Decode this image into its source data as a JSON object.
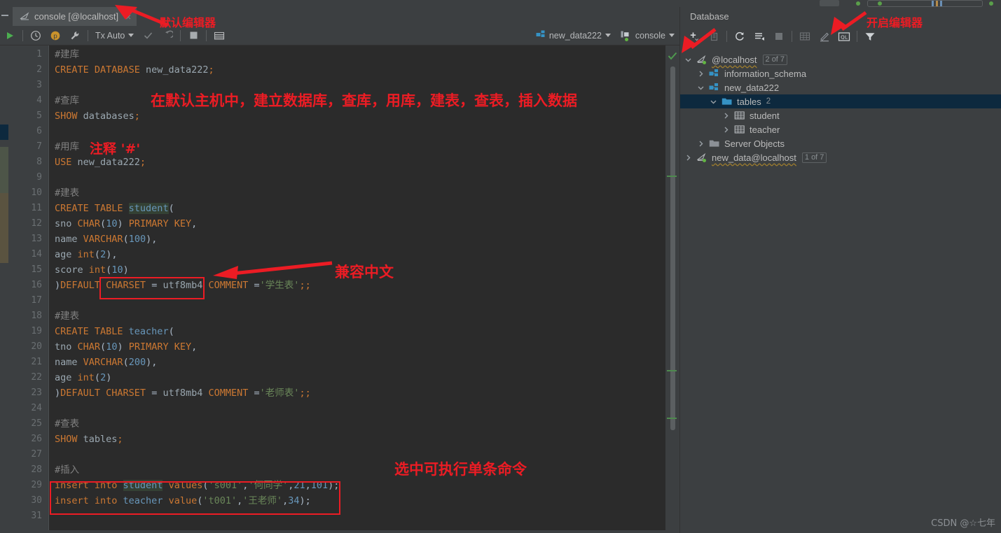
{
  "window": {
    "editor_tab": {
      "label": "console [@localhost]",
      "icon": "console-tab-icon",
      "close": "×"
    }
  },
  "editor_toolbar": {
    "run": "run-icon",
    "history": "history-icon",
    "profile": "profile-icon",
    "wrench": "wrench-icon",
    "tx_mode": "Tx Auto",
    "commit": "commit-check-icon",
    "rollback": "rollback-icon",
    "stop": "stop-icon",
    "grid": "table-grid-icon",
    "schema_chip": "new_data222",
    "session_chip": "console"
  },
  "code": {
    "lines": [
      {
        "n": 1,
        "tokens": [
          {
            "t": "#建库",
            "c": "cm"
          }
        ]
      },
      {
        "n": 2,
        "tokens": [
          {
            "t": "CREATE DATABASE ",
            "c": "k"
          },
          {
            "t": "new_data222",
            "c": "id"
          },
          {
            "t": ";",
            "c": "k"
          }
        ]
      },
      {
        "n": 3,
        "tokens": []
      },
      {
        "n": 4,
        "tokens": [
          {
            "t": "#查库",
            "c": "cm"
          }
        ]
      },
      {
        "n": 5,
        "tokens": [
          {
            "t": "SHOW ",
            "c": "k"
          },
          {
            "t": "databases",
            "c": "id"
          },
          {
            "t": ";",
            "c": "k"
          }
        ]
      },
      {
        "n": 6,
        "tokens": []
      },
      {
        "n": 7,
        "tokens": [
          {
            "t": "#用库",
            "c": "cm"
          }
        ]
      },
      {
        "n": 8,
        "tokens": [
          {
            "t": "USE ",
            "c": "k"
          },
          {
            "t": "new_data222",
            "c": "id"
          },
          {
            "t": ";",
            "c": "k"
          }
        ]
      },
      {
        "n": 9,
        "tokens": []
      },
      {
        "n": 10,
        "tokens": [
          {
            "t": "#建表",
            "c": "cm"
          }
        ]
      },
      {
        "n": 11,
        "tokens": [
          {
            "t": "CREATE TABLE ",
            "c": "k"
          },
          {
            "t": "student",
            "c": "tb hl"
          },
          {
            "t": "(",
            "c": "pn"
          }
        ]
      },
      {
        "n": 12,
        "tokens": [
          {
            "t": "sno",
            "c": "id"
          },
          {
            "t": " ",
            "c": "pn"
          },
          {
            "t": "CHAR",
            "c": "k"
          },
          {
            "t": "(",
            "c": "pn"
          },
          {
            "t": "10",
            "c": "nm"
          },
          {
            "t": ") ",
            "c": "pn"
          },
          {
            "t": "PRIMARY KEY",
            "c": "k"
          },
          {
            "t": ",",
            "c": "pn"
          }
        ]
      },
      {
        "n": 13,
        "tokens": [
          {
            "t": "name",
            "c": "id"
          },
          {
            "t": " ",
            "c": "pn"
          },
          {
            "t": "VARCHAR",
            "c": "k"
          },
          {
            "t": "(",
            "c": "pn"
          },
          {
            "t": "100",
            "c": "nm"
          },
          {
            "t": "),",
            "c": "pn"
          }
        ]
      },
      {
        "n": 14,
        "tokens": [
          {
            "t": "age",
            "c": "id"
          },
          {
            "t": " ",
            "c": "pn"
          },
          {
            "t": "int",
            "c": "k"
          },
          {
            "t": "(",
            "c": "pn"
          },
          {
            "t": "2",
            "c": "nm"
          },
          {
            "t": "),",
            "c": "pn"
          }
        ]
      },
      {
        "n": 15,
        "tokens": [
          {
            "t": "score",
            "c": "id"
          },
          {
            "t": " ",
            "c": "pn"
          },
          {
            "t": "int",
            "c": "k"
          },
          {
            "t": "(",
            "c": "pn"
          },
          {
            "t": "10",
            "c": "nm"
          },
          {
            "t": ")",
            "c": "pn"
          }
        ]
      },
      {
        "n": 16,
        "tokens": [
          {
            "t": ")",
            "c": "pn"
          },
          {
            "t": "DEFAULT CHARSET",
            "c": "k"
          },
          {
            "t": " = ",
            "c": "pn"
          },
          {
            "t": "utf8mb4",
            "c": "id"
          },
          {
            "t": " ",
            "c": "pn"
          },
          {
            "t": "COMMENT",
            "c": "k"
          },
          {
            "t": " =",
            "c": "pn"
          },
          {
            "t": "'学生表'",
            "c": "st"
          },
          {
            "t": ";;",
            "c": "k"
          }
        ]
      },
      {
        "n": 17,
        "tokens": []
      },
      {
        "n": 18,
        "tokens": [
          {
            "t": "#建表",
            "c": "cm"
          }
        ]
      },
      {
        "n": 19,
        "tokens": [
          {
            "t": "CREATE TABLE ",
            "c": "k"
          },
          {
            "t": "teacher",
            "c": "tb"
          },
          {
            "t": "(",
            "c": "pn"
          }
        ]
      },
      {
        "n": 20,
        "tokens": [
          {
            "t": "tno",
            "c": "id"
          },
          {
            "t": " ",
            "c": "pn"
          },
          {
            "t": "CHAR",
            "c": "k"
          },
          {
            "t": "(",
            "c": "pn"
          },
          {
            "t": "10",
            "c": "nm"
          },
          {
            "t": ") ",
            "c": "pn"
          },
          {
            "t": "PRIMARY KEY",
            "c": "k"
          },
          {
            "t": ",",
            "c": "pn"
          }
        ]
      },
      {
        "n": 21,
        "tokens": [
          {
            "t": "name",
            "c": "id"
          },
          {
            "t": " ",
            "c": "pn"
          },
          {
            "t": "VARCHAR",
            "c": "k"
          },
          {
            "t": "(",
            "c": "pn"
          },
          {
            "t": "200",
            "c": "nm"
          },
          {
            "t": "),",
            "c": "pn"
          }
        ]
      },
      {
        "n": 22,
        "tokens": [
          {
            "t": "age",
            "c": "id"
          },
          {
            "t": " ",
            "c": "pn"
          },
          {
            "t": "int",
            "c": "k"
          },
          {
            "t": "(",
            "c": "pn"
          },
          {
            "t": "2",
            "c": "nm"
          },
          {
            "t": ")",
            "c": "pn"
          }
        ]
      },
      {
        "n": 23,
        "tokens": [
          {
            "t": ")",
            "c": "pn"
          },
          {
            "t": "DEFAULT CHARSET",
            "c": "k"
          },
          {
            "t": " = ",
            "c": "pn"
          },
          {
            "t": "utf8mb4",
            "c": "id"
          },
          {
            "t": " ",
            "c": "pn"
          },
          {
            "t": "COMMENT",
            "c": "k"
          },
          {
            "t": " =",
            "c": "pn"
          },
          {
            "t": "'老师表'",
            "c": "st"
          },
          {
            "t": ";;",
            "c": "k"
          }
        ]
      },
      {
        "n": 24,
        "tokens": []
      },
      {
        "n": 25,
        "tokens": [
          {
            "t": "#查表",
            "c": "cm"
          }
        ]
      },
      {
        "n": 26,
        "tokens": [
          {
            "t": "SHOW ",
            "c": "k"
          },
          {
            "t": "tables",
            "c": "id"
          },
          {
            "t": ";",
            "c": "k"
          }
        ]
      },
      {
        "n": 27,
        "tokens": []
      },
      {
        "n": 28,
        "tokens": [
          {
            "t": "#插入",
            "c": "cm"
          }
        ]
      },
      {
        "n": 29,
        "tokens": [
          {
            "t": "insert into ",
            "c": "k"
          },
          {
            "t": "student",
            "c": "tb hl"
          },
          {
            "t": " ",
            "c": "pn"
          },
          {
            "t": "values",
            "c": "k"
          },
          {
            "t": "(",
            "c": "pn"
          },
          {
            "t": "'s001'",
            "c": "st"
          },
          {
            "t": ",",
            "c": "pn"
          },
          {
            "t": "'何同学'",
            "c": "st"
          },
          {
            "t": ",",
            "c": "pn"
          },
          {
            "t": "21",
            "c": "nm"
          },
          {
            "t": ",",
            "c": "pn"
          },
          {
            "t": "101",
            "c": "nm"
          },
          {
            "t": ");",
            "c": "pn"
          }
        ]
      },
      {
        "n": 30,
        "tokens": [
          {
            "t": "insert into ",
            "c": "k"
          },
          {
            "t": "teacher",
            "c": "tb"
          },
          {
            "t": " ",
            "c": "pn"
          },
          {
            "t": "value",
            "c": "k"
          },
          {
            "t": "(",
            "c": "pn"
          },
          {
            "t": "'t001'",
            "c": "st"
          },
          {
            "t": ",",
            "c": "pn"
          },
          {
            "t": "'王老师'",
            "c": "st"
          },
          {
            "t": ",",
            "c": "pn"
          },
          {
            "t": "34",
            "c": "nm"
          },
          {
            "t": ");",
            "c": "pn"
          }
        ]
      },
      {
        "n": 31,
        "tokens": []
      }
    ]
  },
  "database_panel": {
    "title": "Database",
    "toolbar": {
      "add": "plus-icon",
      "copy": "duplicate-icon",
      "refresh": "refresh-icon",
      "sync": "sync-schema-icon",
      "stop": "stop-icon",
      "table_editor": "table-editor-icon",
      "modify": "modify-icon",
      "query_console": "query-console-icon",
      "filter": "filter-icon"
    },
    "tree": [
      {
        "depth": 0,
        "label": "@localhost",
        "icon": "datasource-icon",
        "badge": "2 of 7",
        "state": "expanded",
        "selected": false,
        "warn": true,
        "live": true
      },
      {
        "depth": 1,
        "label": "information_schema",
        "icon": "schema-icon",
        "badge": "",
        "state": "collapsed",
        "selected": false,
        "warn": false,
        "live": false
      },
      {
        "depth": 1,
        "label": "new_data222",
        "icon": "schema-icon",
        "badge": "",
        "state": "expanded",
        "selected": false,
        "warn": false,
        "live": false
      },
      {
        "depth": 2,
        "label": "tables",
        "icon": "folder-icon",
        "count": "2",
        "state": "expanded",
        "selected": true,
        "warn": false,
        "live": false
      },
      {
        "depth": 3,
        "label": "student",
        "icon": "table-icon",
        "badge": "",
        "state": "collapsed",
        "selected": false,
        "warn": false,
        "live": false
      },
      {
        "depth": 3,
        "label": "teacher",
        "icon": "table-icon",
        "badge": "",
        "state": "collapsed",
        "selected": false,
        "warn": false,
        "live": false
      },
      {
        "depth": 1,
        "label": "Server Objects",
        "icon": "folder-gray-icon",
        "badge": "",
        "state": "collapsed",
        "selected": false,
        "warn": false,
        "live": false
      },
      {
        "depth": 0,
        "label": "new_data@localhost",
        "icon": "datasource-icon",
        "badge": "1 of 7",
        "state": "collapsed",
        "selected": false,
        "warn": true,
        "live": true
      }
    ]
  },
  "annotations": {
    "default_editor": "默认编辑器",
    "open_editor": "开启编辑器",
    "main_note": "在默认主机中，建立数据库，查库，用库，建表，查表，插入数据",
    "comment_note": "注释 '#'",
    "charset_note": "兼容中文",
    "select_note": "选中可执行单条命令"
  },
  "watermark": "CSDN @☆七年",
  "colors": {
    "accent_red": "#ec1c24",
    "keyword": "#cc7832",
    "string": "#6a8759",
    "number": "#6897bb",
    "comment": "#808080",
    "editor_bg": "#2b2b2b",
    "chrome_bg": "#3c3f41",
    "selection_bg": "#0d293e"
  }
}
